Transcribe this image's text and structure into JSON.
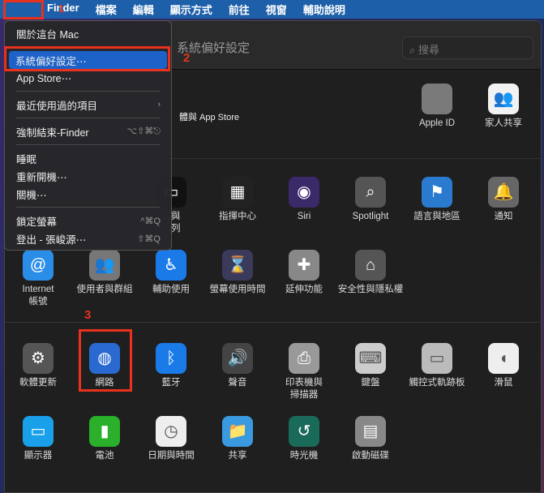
{
  "menubar": {
    "apple": "",
    "items": [
      "Finder",
      "檔案",
      "編輯",
      "顯示方式",
      "前往",
      "視窗",
      "輔助說明"
    ]
  },
  "window": {
    "title": "系統偏好設定",
    "search_placeholder": "搜尋",
    "appstore_partial": "體與 App Store",
    "top": [
      {
        "label": "Apple ID",
        "icon": "apple-icon",
        "color": "#7a7a7a"
      },
      {
        "label": "家人共享",
        "icon": "family-icon",
        "color": "#f2f2f2"
      }
    ],
    "row1": [
      {
        "label": "…與\n…列",
        "icon": "dock-icon",
        "color": "#111"
      },
      {
        "label": "指揮中心",
        "icon": "mission-control-icon",
        "color": "#222"
      },
      {
        "label": "Siri",
        "icon": "siri-icon",
        "color": "#3a2a6a"
      },
      {
        "label": "Spotlight",
        "icon": "spotlight-icon",
        "color": "#555"
      },
      {
        "label": "語言與地區",
        "icon": "flag-icon",
        "color": "#2a7ad0"
      },
      {
        "label": "通知",
        "icon": "bell-icon",
        "color": "#666"
      }
    ],
    "row2": [
      {
        "label": "Internet\n帳號",
        "icon": "at-icon",
        "color": "#2a8ee8"
      },
      {
        "label": "使用者與群組",
        "icon": "users-icon",
        "color": "#777"
      },
      {
        "label": "輔助使用",
        "icon": "accessibility-icon",
        "color": "#1a7ae8"
      },
      {
        "label": "螢幕使用時間",
        "icon": "hourglass-icon",
        "color": "#3a3a5a"
      },
      {
        "label": "延伸功能",
        "icon": "puzzle-icon",
        "color": "#888"
      },
      {
        "label": "安全性與隱私權",
        "icon": "house-lock-icon",
        "color": "#555"
      }
    ],
    "row3": [
      {
        "label": "軟體更新",
        "icon": "gear-icon",
        "color": "#555"
      },
      {
        "label": "網路",
        "icon": "globe-icon",
        "color": "#2a6ad0"
      },
      {
        "label": "藍牙",
        "icon": "bluetooth-icon",
        "color": "#1a7ae8"
      },
      {
        "label": "聲音",
        "icon": "speaker-icon",
        "color": "#444"
      },
      {
        "label": "印表機與\n掃描器",
        "icon": "printer-icon",
        "color": "#999"
      },
      {
        "label": "鍵盤",
        "icon": "keyboard-icon",
        "color": "#ccc"
      },
      {
        "label": "觸控式軌跡板",
        "icon": "trackpad-icon",
        "color": "#bbb"
      },
      {
        "label": "滑鼠",
        "icon": "mouse-icon",
        "color": "#eee"
      }
    ],
    "row4": [
      {
        "label": "顯示器",
        "icon": "display-icon",
        "color": "#1aa0e8"
      },
      {
        "label": "電池",
        "icon": "battery-icon",
        "color": "#2ab02a"
      },
      {
        "label": "日期與時間",
        "icon": "clock-icon",
        "color": "#eee"
      },
      {
        "label": "共享",
        "icon": "folder-icon",
        "color": "#3a9ae0"
      },
      {
        "label": "時光機",
        "icon": "time-machine-icon",
        "color": "#1a6a5a"
      },
      {
        "label": "啟動磁碟",
        "icon": "disk-icon",
        "color": "#888"
      }
    ]
  },
  "menu": {
    "items": [
      {
        "label": "關於這台 Mac"
      },
      {
        "sep": true
      },
      {
        "label": "系統偏好設定⋯",
        "selected": true
      },
      {
        "label": "App Store⋯"
      },
      {
        "sep": true
      },
      {
        "label": "最近使用過的項目",
        "shortcut": "›"
      },
      {
        "sep": true
      },
      {
        "label": "強制結束-Finder",
        "shortcut": "⌥⇧⌘⎋"
      },
      {
        "sep": true
      },
      {
        "label": "睡眠"
      },
      {
        "label": "重新開機⋯"
      },
      {
        "label": "關機⋯"
      },
      {
        "sep": true
      },
      {
        "label": "鎖定螢幕",
        "shortcut": "^⌘Q"
      },
      {
        "label": "登出 - 張峻源⋯",
        "shortcut": "⇧⌘Q"
      }
    ]
  },
  "annotations": [
    "1",
    "2",
    "3"
  ],
  "accent": "#e8321e"
}
